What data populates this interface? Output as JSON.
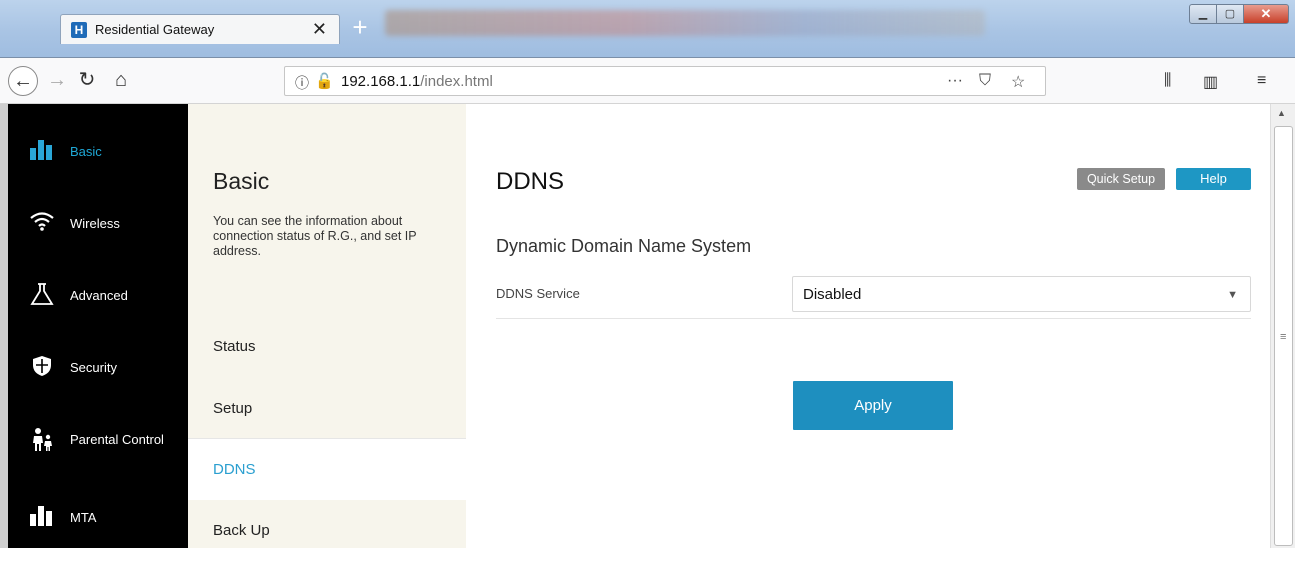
{
  "browser": {
    "tab_title": "Residential Gateway",
    "favicon_letter": "H",
    "tab_close": "✕",
    "new_tab": "+",
    "url_host": "192.168.1.1",
    "url_path": "/index.html",
    "window_buttons": {
      "minimize": "▁",
      "maximize": "▢",
      "close": "✕"
    }
  },
  "sidebar": {
    "items": [
      {
        "label": "Basic",
        "icon": "bar-chart-icon",
        "glyph": "▂▆▄"
      },
      {
        "label": "Wireless",
        "icon": "wifi-icon",
        "glyph": "◠"
      },
      {
        "label": "Advanced",
        "icon": "flask-icon",
        "glyph": "⚗"
      },
      {
        "label": "Security",
        "icon": "shield-icon",
        "glyph": "⛊"
      },
      {
        "label": "Parental Control",
        "icon": "family-icon",
        "glyph": "⚇"
      },
      {
        "label": "MTA",
        "icon": "mta-icon",
        "glyph": "▂▆▄"
      }
    ]
  },
  "submenu": {
    "title": "Basic",
    "description": "You can see the information about connection status of R.G., and set IP address.",
    "items": [
      "Status",
      "Setup",
      "DDNS",
      "Back Up"
    ]
  },
  "main": {
    "title": "DDNS",
    "quick_setup": "Quick Setup",
    "help": "Help",
    "subtitle": "Dynamic Domain Name System",
    "ddns_service_label": "DDNS Service",
    "ddns_service_value": "Disabled",
    "apply": "Apply"
  },
  "colors": {
    "accent": "#1e8fbf",
    "active_text": "#2a9fd0",
    "sidebar_bg": "#000000",
    "submenu_bg": "#f7f5ec"
  }
}
